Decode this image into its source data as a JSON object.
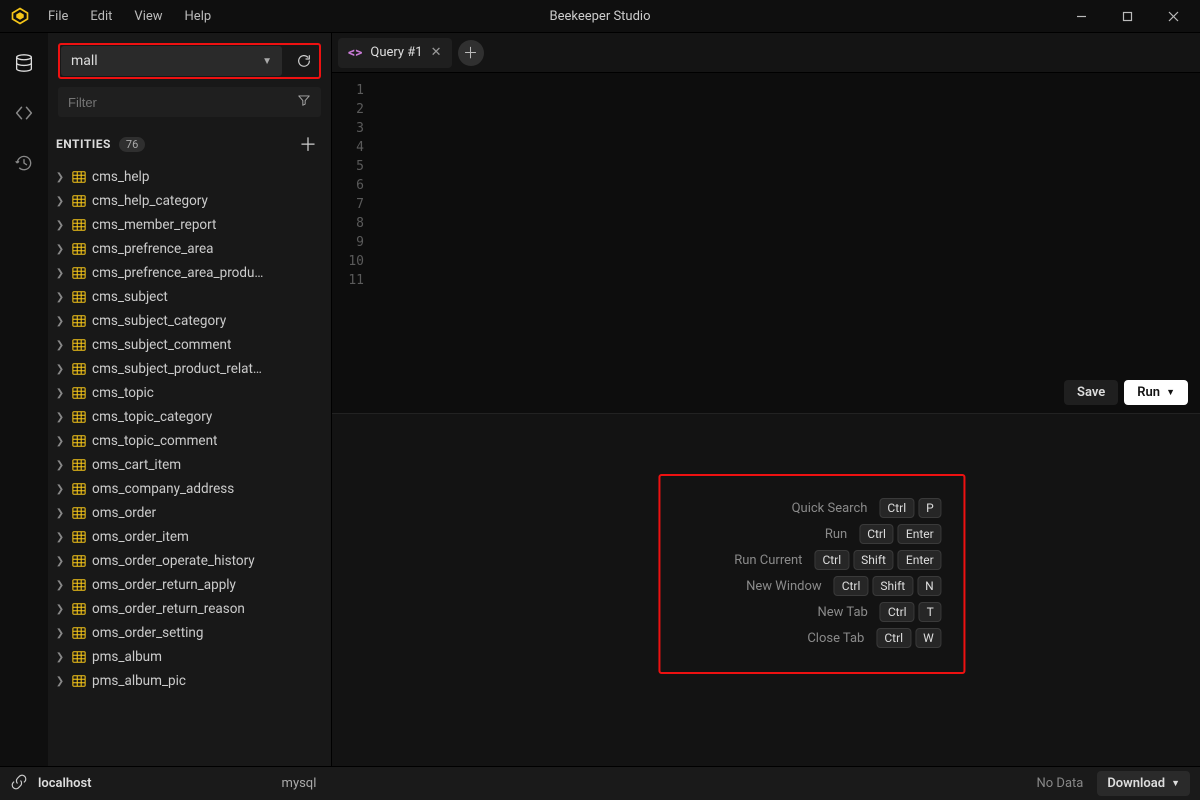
{
  "app": {
    "title": "Beekeeper Studio"
  },
  "menu": {
    "file": "File",
    "edit": "Edit",
    "view": "View",
    "help": "Help"
  },
  "sidebar": {
    "db_name": "mall",
    "filter_placeholder": "Filter",
    "entities_label": "ENTITIES",
    "entities_count": "76",
    "entities": [
      "cms_help",
      "cms_help_category",
      "cms_member_report",
      "cms_prefrence_area",
      "cms_prefrence_area_produ…",
      "cms_subject",
      "cms_subject_category",
      "cms_subject_comment",
      "cms_subject_product_relat…",
      "cms_topic",
      "cms_topic_category",
      "cms_topic_comment",
      "oms_cart_item",
      "oms_company_address",
      "oms_order",
      "oms_order_item",
      "oms_order_operate_history",
      "oms_order_return_apply",
      "oms_order_return_reason",
      "oms_order_setting",
      "pms_album",
      "pms_album_pic"
    ]
  },
  "tabs": {
    "query1": "Query #1"
  },
  "editor": {
    "line_count": 11,
    "save_label": "Save",
    "run_label": "Run"
  },
  "shortcuts": [
    {
      "name": "Quick Search",
      "keys": [
        "Ctrl",
        "P"
      ]
    },
    {
      "name": "Run",
      "keys": [
        "Ctrl",
        "Enter"
      ]
    },
    {
      "name": "Run Current",
      "keys": [
        "Ctrl",
        "Shift",
        "Enter"
      ]
    },
    {
      "name": "New Window",
      "keys": [
        "Ctrl",
        "Shift",
        "N"
      ]
    },
    {
      "name": "New Tab",
      "keys": [
        "Ctrl",
        "T"
      ]
    },
    {
      "name": "Close Tab",
      "keys": [
        "Ctrl",
        "W"
      ]
    }
  ],
  "status": {
    "host": "localhost",
    "engine": "mysql",
    "nodata": "No Data",
    "download": "Download"
  }
}
